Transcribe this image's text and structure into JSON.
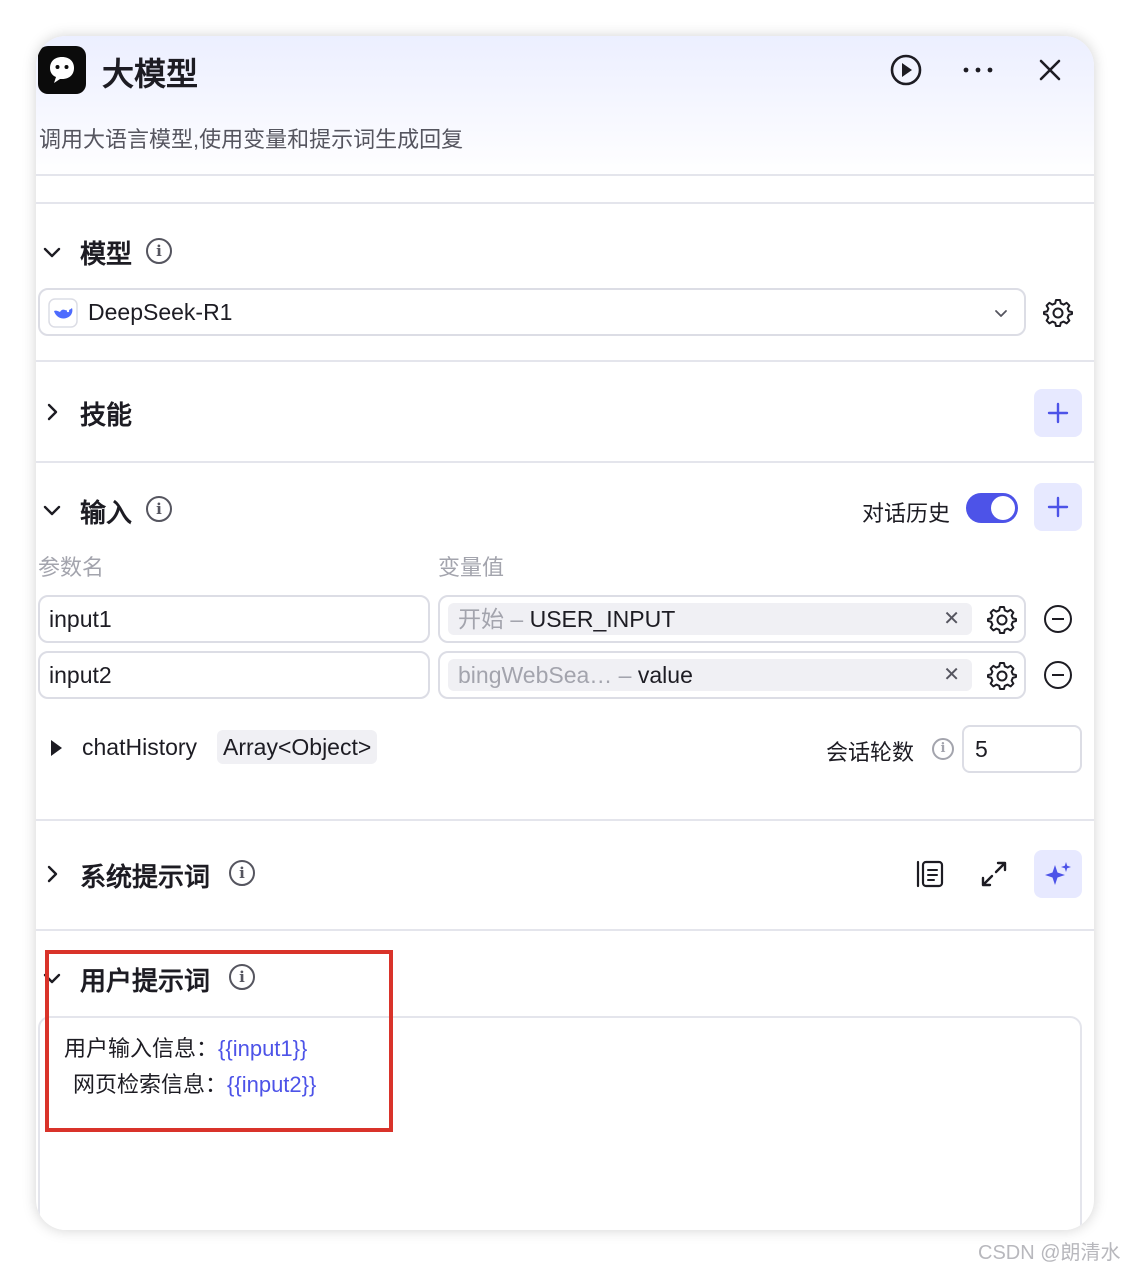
{
  "header": {
    "title": "大模型",
    "description": "调用大语言模型,使用变量和提示词生成回复"
  },
  "model_section": {
    "title": "模型",
    "selected_model": "DeepSeek-R1"
  },
  "skills_section": {
    "title": "技能"
  },
  "input_section": {
    "title": "输入",
    "history_toggle_label": "对话历史",
    "history_enabled": true,
    "column_param": "参数名",
    "column_value": "变量值",
    "rows": [
      {
        "name": "input1",
        "source": "开始",
        "sep": " – ",
        "value": "USER_INPUT"
      },
      {
        "name": "input2",
        "source": "bingWebSea…",
        "sep": " – ",
        "value": "value"
      }
    ],
    "chat_history_name": "chatHistory",
    "chat_history_type": "Array<Object>",
    "rounds_label": "会话轮数",
    "rounds_value": "5"
  },
  "system_prompt_section": {
    "title": "系统提示词"
  },
  "user_prompt_section": {
    "title": "用户提示词",
    "line1_label": "用户输入信息：",
    "line1_var": "{{input1}}",
    "line2_label": "网页检索信息：",
    "line2_var": "{{input2}}"
  },
  "watermark": "CSDN @朗清水",
  "colors": {
    "accent": "#4d53e8",
    "highlight_border": "#d9332a"
  }
}
